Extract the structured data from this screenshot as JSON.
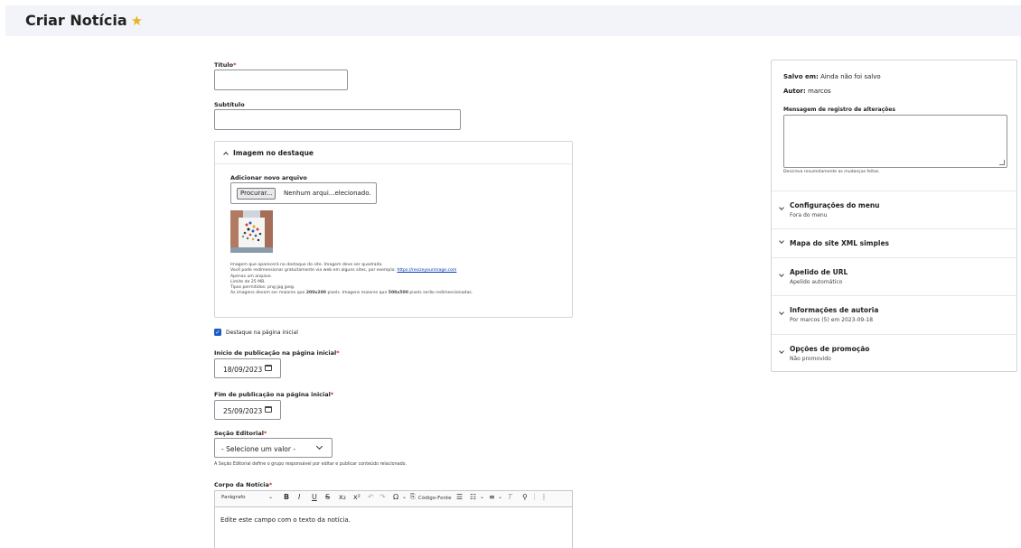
{
  "header": {
    "title": "Criar Notícia",
    "star_icon": "★"
  },
  "form": {
    "titulo": {
      "label": "Título",
      "required_mark": "*",
      "value": ""
    },
    "subtitulo": {
      "label": "Subtítulo",
      "value": ""
    },
    "imagem": {
      "legend": "Imagem no destaque",
      "upload_label": "Adicionar novo arquivo",
      "browse_button": "Procurar...",
      "file_status": "Nenhum arqui...elecionado.",
      "help": {
        "line1": "Imagem que aparecerá no destaque do site. Imagem deve ser quadrada.",
        "line2_prefix": "Você pode redimensionar gratuitamente via web em alguns sites, por exemplo:",
        "line2_link": "https://resizeyourimage.com",
        "line3": "Apenas um arquivo.",
        "line4": "Limite de 25 MB.",
        "line5": "Tipos permitidos: png jpg jpeg.",
        "line6_a": "As imagens devem ser maiores que",
        "line6_b": "200x200",
        "line6_c": "pixels. Imagens maiores que",
        "line6_d": "500x500",
        "line6_e": "pixels serão redimensionadas."
      }
    },
    "destaque": {
      "label": "Destaque na página inicial",
      "checked": true
    },
    "inicio": {
      "label": "Início de publicação na página inicial",
      "required_mark": "*",
      "value": "18/09/2023"
    },
    "fim": {
      "label": "Fim de publicação na página inicial",
      "required_mark": "*",
      "value": "25/09/2023"
    },
    "secao": {
      "label": "Seção Editorial",
      "required_mark": "*",
      "value": "- Selecione um valor -",
      "help": "A Seção Editorial define o grupo responsável por editar e publicar conteúdo relacionado."
    },
    "corpo": {
      "label": "Corpo da Notícia",
      "required_mark": "*",
      "toolbar": {
        "heading": "Parágrafo",
        "bold": "B",
        "italic": "I",
        "underline": "U",
        "strike": "S",
        "subscript": "x₂",
        "superscript": "x²",
        "undo": "↶",
        "redo": "↷",
        "special_chars": "Ω",
        "source": "Código-Fonte"
      },
      "placeholder": "Edite este campo com o texto da notícia."
    }
  },
  "sidebar": {
    "saved_label": "Salvo em:",
    "saved_value": "Ainda não foi salvo",
    "author_label": "Autor:",
    "author_value": "marcos",
    "log_label": "Mensagem de registro de alterações",
    "log_help": "Descreva resumidamente as mudanças feitas.",
    "sections": [
      {
        "title": "Configurações do menu",
        "summary": "Fora do menu"
      },
      {
        "title": "Mapa do site XML simples",
        "summary": ""
      },
      {
        "title": "Apelido de URL",
        "summary": "Apelido automático"
      },
      {
        "title": "Informações de autoria",
        "summary": "Por marcos (5) em 2023-09-18"
      },
      {
        "title": "Opções de promoção",
        "summary": "Não promovido"
      }
    ]
  }
}
